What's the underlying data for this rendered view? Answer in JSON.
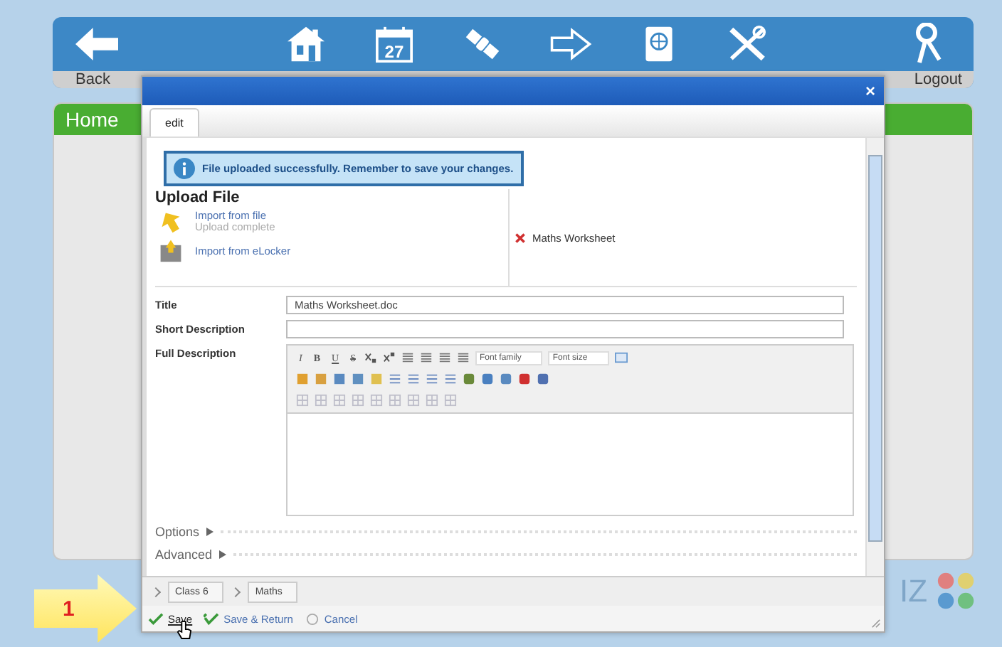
{
  "nav": {
    "back": "Back",
    "logout": "Logout",
    "home": "Home",
    "logo_text": "IZ",
    "calendar_day": "27"
  },
  "dialog": {
    "close": "×",
    "tabs": [
      {
        "label": "edit",
        "selected": true
      }
    ],
    "notice": "File uploaded successfully. Remember to save your changes.",
    "upload": {
      "heading": "Upload File",
      "import_file": "Import from file",
      "status": "Upload complete",
      "import_elocker": "Import from eLocker",
      "files": [
        {
          "name": "Maths Worksheet"
        }
      ]
    },
    "fields": [
      {
        "label": "Title",
        "value": "Maths Worksheet.doc"
      },
      {
        "label": "Short Description"
      }
    ],
    "full_description": {
      "label": "Full Description",
      "format_buttons": [
        {
          "label": "I",
          "kind": "italic"
        },
        {
          "label": "B",
          "kind": "bold"
        },
        {
          "label": "U",
          "kind": "underline"
        },
        {
          "label": "S",
          "kind": "strike"
        }
      ],
      "font_family": "Font family",
      "font_size": "Font size"
    },
    "sections": [
      {
        "label": "Options",
        "expanded": false
      },
      {
        "label": "Advanced",
        "expanded": false
      }
    ],
    "breadcrumb": [
      "Class 6",
      "Maths"
    ],
    "actions": [
      {
        "label": "Save",
        "kind": "save"
      },
      {
        "label": "Save & Return",
        "kind": "save-return"
      },
      {
        "label": "Cancel",
        "kind": "cancel"
      }
    ]
  },
  "callout": "1"
}
